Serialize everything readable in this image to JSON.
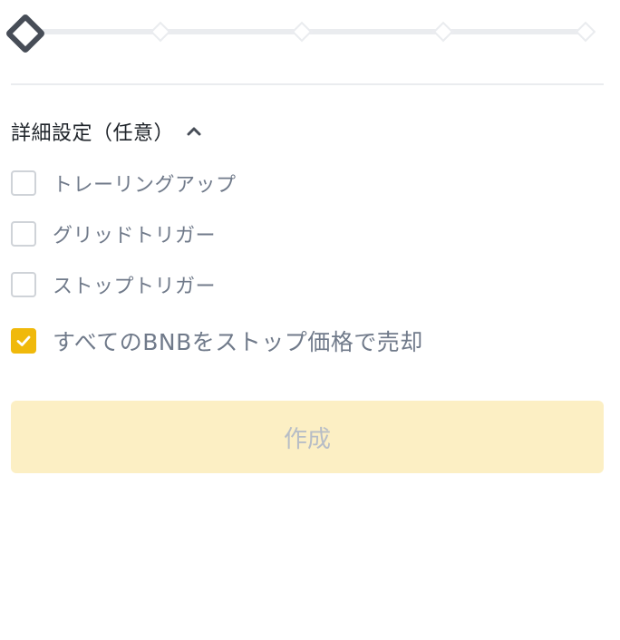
{
  "slider": {
    "value_percent": 0,
    "marks": [
      0,
      25,
      50,
      75,
      100
    ]
  },
  "advanced": {
    "title": "詳細設定（任意）",
    "expanded": true,
    "chevron_icon": "chevron-up-icon"
  },
  "options": [
    {
      "label": "トレーリングアップ",
      "checked": false
    },
    {
      "label": "グリッドトリガー",
      "checked": false
    },
    {
      "label": "ストップトリガー",
      "checked": false
    },
    {
      "label": "すべてのBNBをストップ価格で売却",
      "checked": true
    }
  ],
  "create_button": {
    "label": "作成",
    "disabled": true
  },
  "colors": {
    "accent": "#f0b90b",
    "button_disabled_bg": "#fcefc4",
    "text_secondary": "#707a8a",
    "track": "#eaecef",
    "handle_border": "#474d57"
  }
}
